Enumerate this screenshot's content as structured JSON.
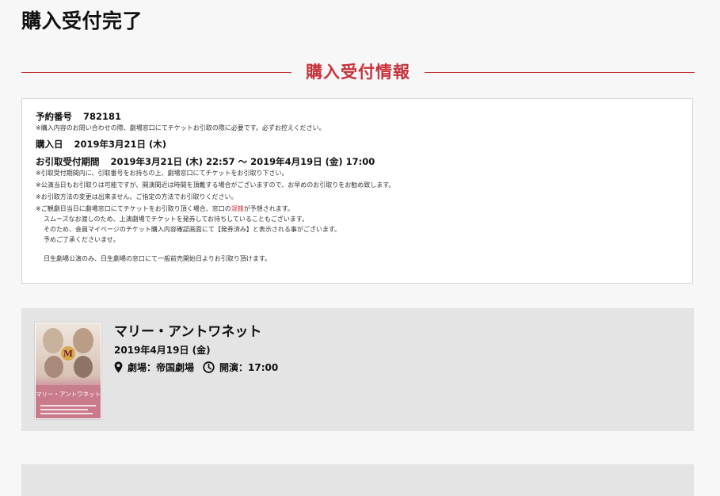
{
  "page": {
    "title": "購入受付完了"
  },
  "section": {
    "heading": "購入受付情報"
  },
  "reservation": {
    "number_label": "予約番号",
    "number_value": "782181",
    "number_note": "※購入内容のお問い合わせの際、劇場窓口にてチケットお引取の際に必要です。必ずお控えください。",
    "purchase_label": "購入日",
    "purchase_value": "2019年3月21日 (木)",
    "pickup_label": "お引取受付期間",
    "pickup_value": "2019年3月21日 (木) 22:57 〜 2019年4月19日 (金) 17:00",
    "notes": [
      "※引取受付期間内に、引取番号をお持ちの上、劇場窓口にてチケットをお引取り下さい。",
      "※公演当日もお引取りは可能ですが、開演間近は時間を頂戴する場合がございますので、お早めのお引取りをお勧め致します。",
      "※お引取方法の変更は出来ません。ご指定の方法でお引取りください。"
    ],
    "congestion_note_before": "※ご観劇日当日に劇場窓口にてチケットをお引取り頂く場合、窓口の",
    "congestion_note_highlight": "混雑",
    "congestion_note_after": "が予想されます。",
    "congestion_lines": [
      "スムーズなお渡しのため、上演劇場でチケットを発券してお待ちしていることもございます。",
      "そのため、会員マイページのチケット購入内容確認画面にて【発券済み】と表示される事がございます。",
      "予めご了承くださいませ。"
    ],
    "nissay_note": "日生劇場公演のみ、日生劇場の窓口にて一般前売開始日よりお引取り頂けます。"
  },
  "event": {
    "title": "マリー・アントワネット",
    "date": "2019年4月19日 (金)",
    "venue": "劇場：帝国劇場",
    "start": "開演：17:00",
    "poster_title": "マリー・アントワネット",
    "icons": {
      "venue": "map-pin-icon",
      "start": "clock-icon"
    }
  },
  "colors": {
    "accent": "#c8323a",
    "card_bg": "#e4e4e4",
    "page_bg": "#f7f7f7"
  }
}
